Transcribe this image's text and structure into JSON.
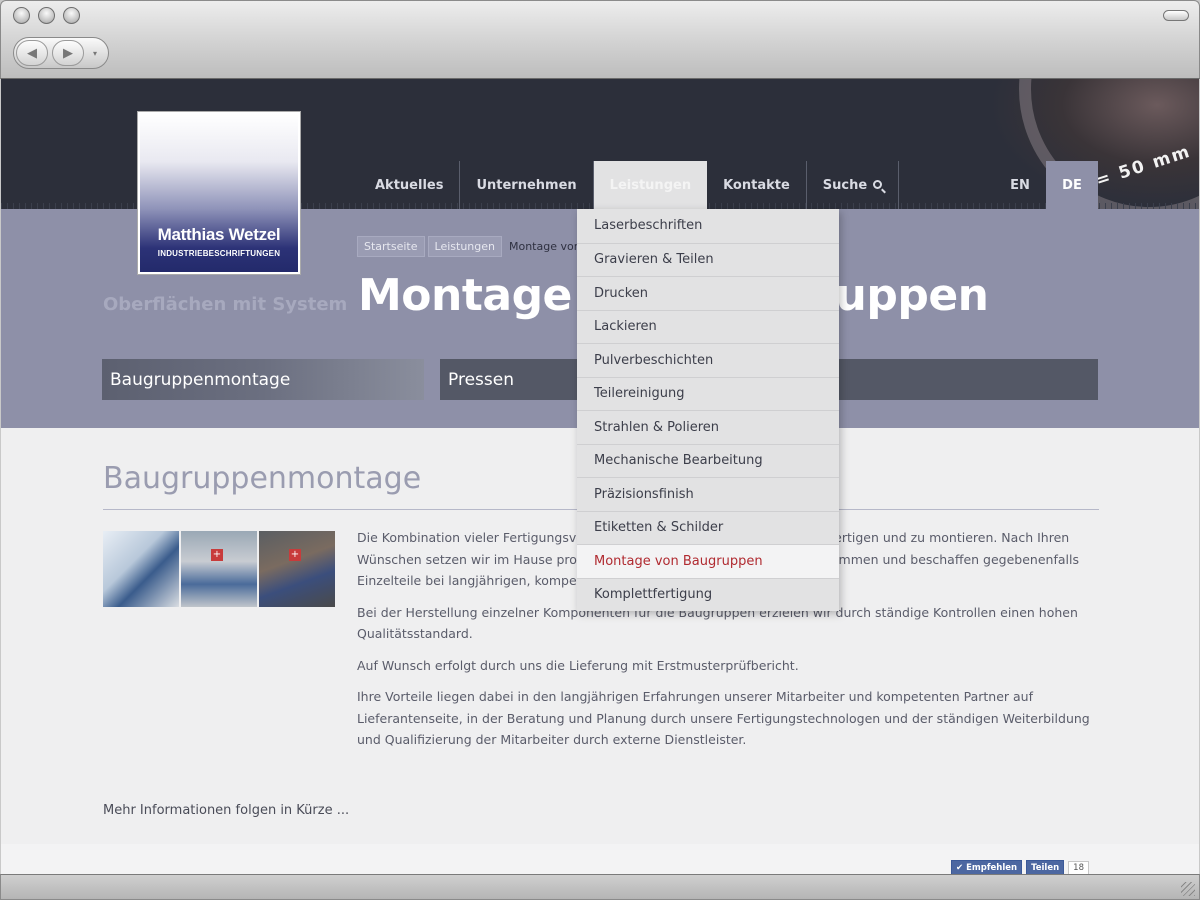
{
  "site": {
    "logo": {
      "name": "Matthias Wetzel",
      "subtitle": "INDUSTRIEBESCHRIFTUNGEN"
    },
    "tagline": "Oberflächen mit System",
    "lens_text": "f = 50 mm"
  },
  "nav": {
    "items": [
      {
        "label": "Aktuelles"
      },
      {
        "label": "Unternehmen"
      },
      {
        "label": "Leistungen",
        "active": true
      },
      {
        "label": "Kontakte"
      },
      {
        "label": "Suche",
        "icon": "search-icon"
      }
    ],
    "languages": [
      {
        "label": "EN"
      },
      {
        "label": "DE",
        "active": true
      }
    ]
  },
  "dropdown": {
    "items": [
      "Laserbeschriften",
      "Gravieren & Teilen",
      "Drucken",
      "Lackieren",
      "Pulverbeschichten",
      "Teilereinigung",
      "Strahlen & Polieren",
      "Mechanische Bearbeitung",
      "Präzisionsfinish",
      "Etiketten & Schilder",
      "Montage von Baugruppen",
      "Komplettfertigung"
    ],
    "current": "Montage von Baugruppen"
  },
  "breadcrumb": [
    "Startseite",
    "Leistungen",
    "Montage von Baug"
  ],
  "page_title": "Montage von Baugruppen",
  "tabs": [
    "Baugruppenmontage",
    "Pressen"
  ],
  "section": {
    "title": "Baugruppenmontage",
    "paragraphs": [
      "Die Kombination vieler Fertigungsverfahren erlaubt es uns, Baugruppen zu fertigen und zu montieren. Nach Ihren Wünschen setzen wir im Hause produzierte Einzelteile zu Komponenten zusammen und beschaffen gegebenenfalls Einzelteile bei langjährigen, kompetenten Partnern.",
      "Bei der Herstellung einzelner Komponenten für die Baugruppen erzielen wir durch ständige Kontrollen einen hohen Qualitätsstandard.",
      "Auf Wunsch erfolgt durch uns die Lieferung mit Erstmusterprüfbericht.",
      "Ihre Vorteile liegen dabei in den langjährigen Erfahrungen unserer Mitarbeiter und kompetenten Partner auf Lieferantenseite, in der Beratung und Planung durch unsere Fertigungstechnologen und der ständigen Weiterbildung und Qualifizierung der Mitarbeiter durch externe Dienstleister."
    ],
    "footer_note": "Mehr Informationen folgen in Kürze ..."
  },
  "social": {
    "recommend": "✔ Empfehlen",
    "share": "Teilen",
    "count": "18"
  },
  "browser": {
    "back": "◀",
    "forward": "▶"
  }
}
